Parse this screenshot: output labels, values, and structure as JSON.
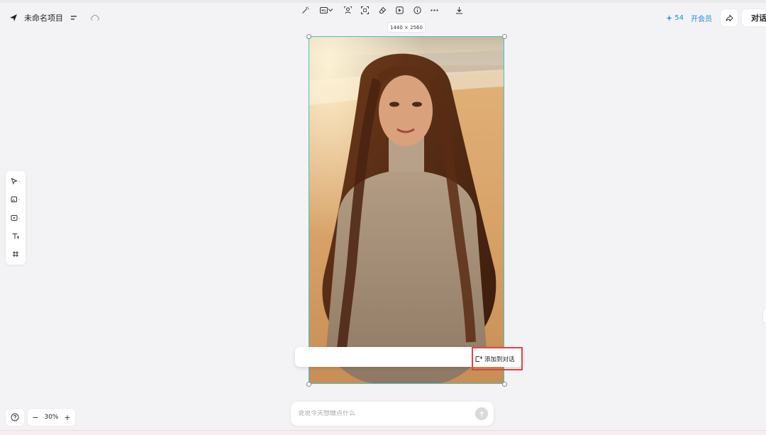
{
  "header": {
    "project_name": "未命名项目",
    "credits": "54",
    "vip_label": "开会员",
    "chat_label": "对话"
  },
  "canvas": {
    "image_size_label": "1440 × 2560"
  },
  "image_toolbar": {
    "add_to_chat_label": "添加到对话"
  },
  "zoom": {
    "level": "30%",
    "minus": "−",
    "plus": "+"
  },
  "prompt": {
    "placeholder": "说说今天想做点什么"
  },
  "colors": {
    "accent": "#1a8fd8",
    "selection": "#3cc3c3",
    "highlight_box": "#e14545"
  }
}
